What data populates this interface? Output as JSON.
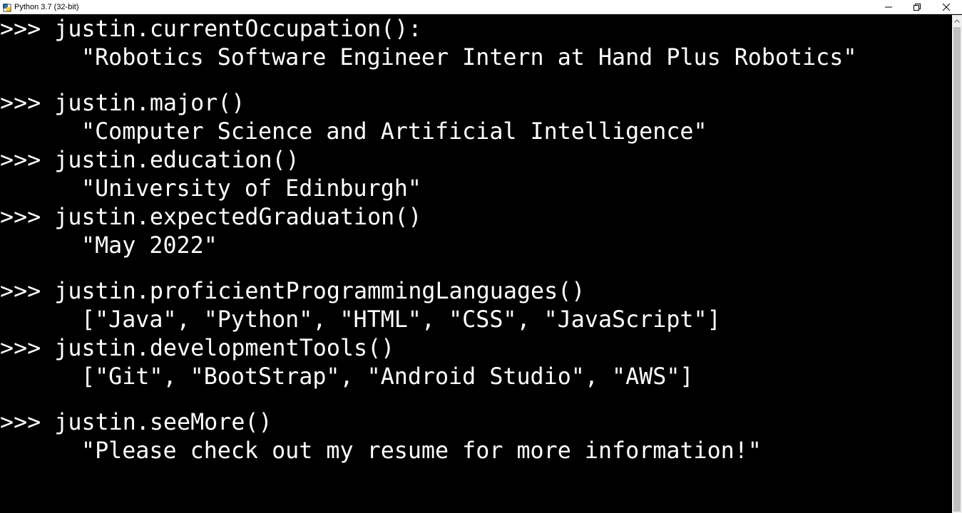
{
  "window": {
    "title": "Python 3.7 (32-bit)",
    "app_icon": "python-icon",
    "controls": [
      "minimize-icon",
      "maximize-icon",
      "close-icon"
    ]
  },
  "console": {
    "lines": [
      {
        "type": "prompt",
        "text": ">>> justin.currentOccupation():"
      },
      {
        "type": "output",
        "text": "\"Robotics Software Engineer Intern at Hand Plus Robotics\""
      },
      {
        "type": "prompt",
        "text": ">>> justin.major()"
      },
      {
        "type": "output",
        "text": "\"Computer Science and Artificial Intelligence\""
      },
      {
        "type": "prompt",
        "text": ">>> justin.education()"
      },
      {
        "type": "output",
        "text": "\"University of Edinburgh\""
      },
      {
        "type": "prompt",
        "text": ">>> justin.expectedGraduation()"
      },
      {
        "type": "output",
        "text": "\"May 2022\""
      },
      {
        "type": "prompt",
        "text": ">>> justin.proficientProgrammingLanguages()"
      },
      {
        "type": "output",
        "text": "[\"Java\", \"Python\", \"HTML\", \"CSS\", \"JavaScript\"]"
      },
      {
        "type": "prompt",
        "text": ">>> justin.developmentTools()"
      },
      {
        "type": "output",
        "text": "[\"Git\", \"BootStrap\", \"Android Studio\", \"AWS\"]"
      },
      {
        "type": "prompt",
        "text": ">>> justin.seeMore()"
      },
      {
        "type": "output",
        "text": "\"Please check out my resume for more information!\""
      }
    ]
  }
}
